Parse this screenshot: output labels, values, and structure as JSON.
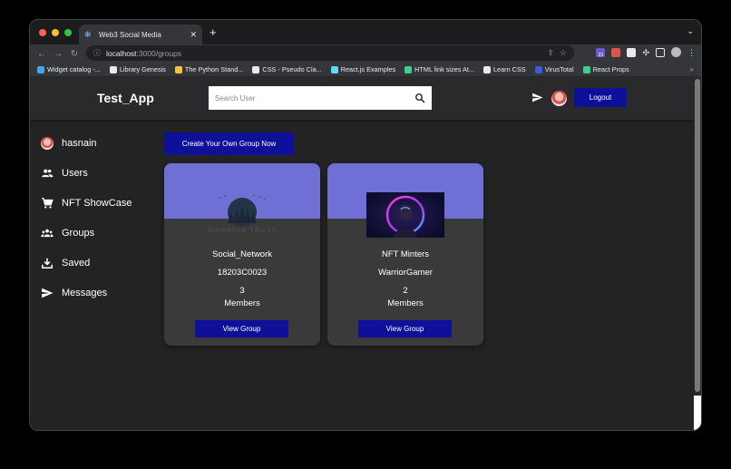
{
  "browser": {
    "tab_title": "Web3 Social Media",
    "url_host": "localhost",
    "url_path": ":3000/groups",
    "bookmarks": [
      {
        "label": "Widget catalog -...",
        "color": "#4aa3f0"
      },
      {
        "label": "Library Genesis",
        "color": "#e8eaed"
      },
      {
        "label": "The Python Stand...",
        "color": "#f5c542"
      },
      {
        "label": "CSS - Pseudo Cla...",
        "color": "#e8eaed"
      },
      {
        "label": "React.js Examples",
        "color": "#61dafb"
      },
      {
        "label": "HTML link sizes At...",
        "color": "#3ecf8e"
      },
      {
        "label": "Learn CSS",
        "color": "#e8eaed"
      },
      {
        "label": "VirusTotal",
        "color": "#3b5bdb"
      },
      {
        "label": "React Props",
        "color": "#3ecf8e"
      }
    ],
    "more_bookmarks": "»",
    "extension_badge": "23"
  },
  "app": {
    "logo": "Test_App",
    "search_placeholder": "Search User",
    "logout_label": "Logout",
    "accent": "#0f1099",
    "banner_color": "#6f6fd6"
  },
  "sidebar": {
    "items": [
      {
        "label": "hasnain",
        "icon": "avatar"
      },
      {
        "label": "Users",
        "icon": "users-icon"
      },
      {
        "label": "NFT ShowCase",
        "icon": "cart-icon"
      },
      {
        "label": "Groups",
        "icon": "groups-icon"
      },
      {
        "label": "Saved",
        "icon": "download-icon"
      },
      {
        "label": "Messages",
        "icon": "send-icon"
      }
    ]
  },
  "main": {
    "create_button": "Create Your Own Group Now",
    "groups": [
      {
        "name": "Social_Network",
        "owner": "18203C0023",
        "count": "3",
        "members_label": "Members",
        "button": "View Group",
        "image": "warrior-trust-forest-logo",
        "image_text": "WARRIOR TRUST"
      },
      {
        "name": "NFT Minters",
        "owner": "WarriorGamer",
        "count": "2",
        "members_label": "Members",
        "button": "View Group",
        "image": "neon-ring-portrait"
      }
    ]
  }
}
